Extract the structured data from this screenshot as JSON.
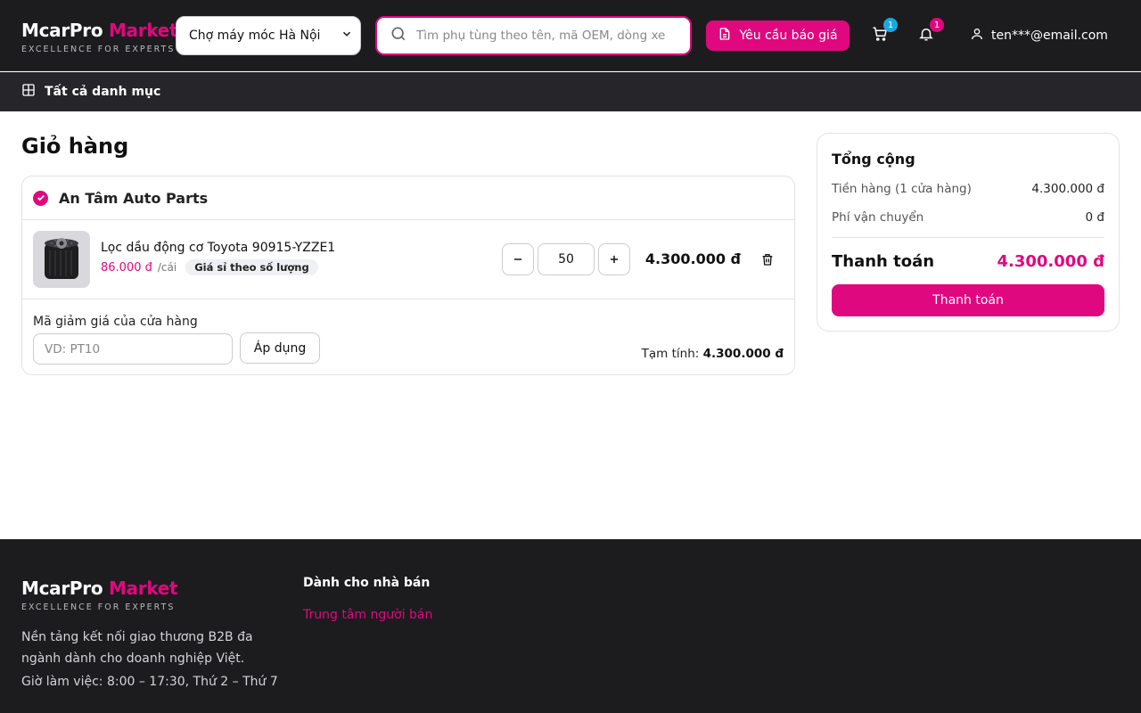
{
  "brand": {
    "name_part1": "McarPro",
    "name_part2": "Market",
    "tagline": "EXCELLENCE FOR EXPERTS"
  },
  "header": {
    "market_select": "Chợ máy móc Hà Nội",
    "search_placeholder": "Tìm phụ tùng theo tên, mã OEM, dòng xe...",
    "quote_button": "Yêu cầu báo giá",
    "cart_count": "1",
    "notif_count": "1",
    "user_email": "ten***@email.com"
  },
  "subnav": {
    "all_categories": "Tất cả danh mục"
  },
  "cart": {
    "title": "Giỏ hàng",
    "shop_name": "An Tâm Auto Parts",
    "item": {
      "name": "Lọc dầu động cơ Toyota 90915-YZZE1",
      "unit_price": "86.000 đ",
      "unit": "/cái",
      "tag": "Giá sỉ theo số lượng",
      "quantity": "50",
      "line_total": "4.300.000 đ"
    },
    "coupon_label": "Mã giảm giá của cửa hàng",
    "coupon_placeholder": "VD: PT10",
    "apply_button": "Áp dụng",
    "subtotal_label": "Tạm tính:",
    "subtotal_value": "4.300.000 đ"
  },
  "summary": {
    "title": "Tổng cộng",
    "goods_label": "Tiền hàng (1 cửa hàng)",
    "goods_value": "4.300.000 đ",
    "shipping_label": "Phí vận chuyển",
    "shipping_value": "0 đ",
    "pay_label": "Thanh toán",
    "pay_value": "4.300.000 đ",
    "pay_button": "Thanh toán"
  },
  "footer": {
    "description": "Nền tảng kết nối giao thương B2B đa ngành dành cho doanh nghiệp Việt.",
    "hours": "Giờ làm việc: 8:00 – 17:30, Thứ 2 – Thứ 7",
    "seller_title": "Dành cho nhà bán",
    "seller_link": "Trung tâm người bán"
  },
  "colors": {
    "accent": "#e0087e",
    "header_bg": "#1c1c1f",
    "cart_badge": "#1ba8e0"
  }
}
